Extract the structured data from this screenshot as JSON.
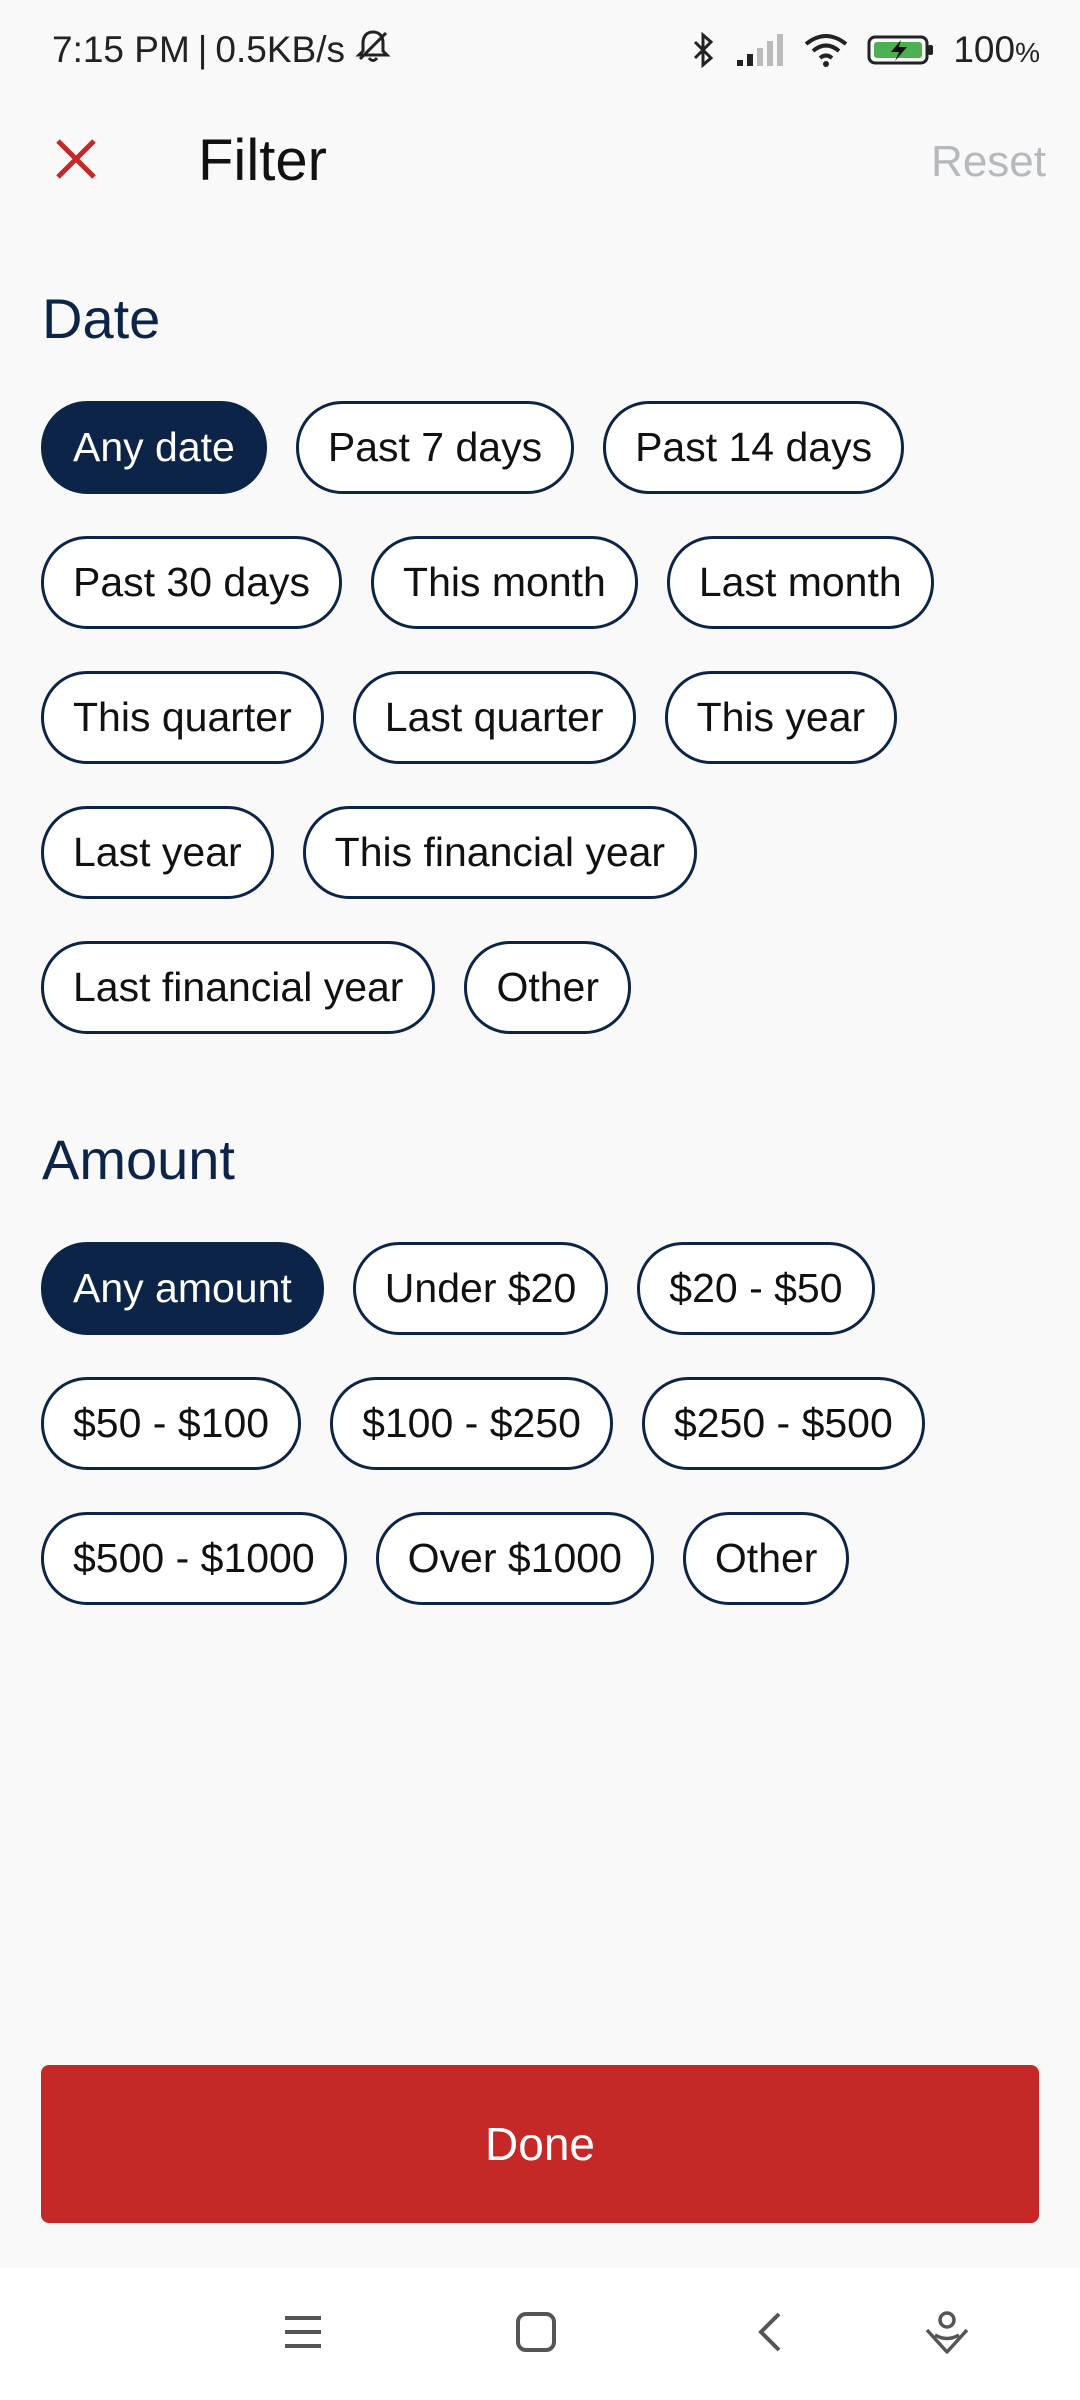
{
  "status_bar": {
    "time": "7:15 PM",
    "separator": "|",
    "network_speed": "0.5KB/s",
    "battery": "100",
    "battery_unit": "%",
    "icons": [
      "mute-bell-icon",
      "bluetooth-icon",
      "signal-icon",
      "wifi-icon",
      "battery-charging-icon"
    ]
  },
  "header": {
    "title": "Filter",
    "reset_label": "Reset",
    "close_icon": "close-icon"
  },
  "date": {
    "title": "Date",
    "options": [
      {
        "label": "Any date",
        "selected": true
      },
      {
        "label": "Past 7 days",
        "selected": false
      },
      {
        "label": "Past 14 days",
        "selected": false
      },
      {
        "label": "Past 30 days",
        "selected": false
      },
      {
        "label": "This month",
        "selected": false
      },
      {
        "label": "Last month",
        "selected": false
      },
      {
        "label": "This quarter",
        "selected": false
      },
      {
        "label": "Last quarter",
        "selected": false
      },
      {
        "label": "This year",
        "selected": false
      },
      {
        "label": "Last year",
        "selected": false
      },
      {
        "label": "This financial year",
        "selected": false
      },
      {
        "label": "Last financial year",
        "selected": false
      },
      {
        "label": "Other",
        "selected": false
      }
    ]
  },
  "amount": {
    "title": "Amount",
    "options": [
      {
        "label": "Any amount",
        "selected": true
      },
      {
        "label": "Under $20",
        "selected": false
      },
      {
        "label": "$20 - $50",
        "selected": false
      },
      {
        "label": "$50 - $100",
        "selected": false
      },
      {
        "label": "$100 - $250",
        "selected": false
      },
      {
        "label": "$250 - $500",
        "selected": false
      },
      {
        "label": "$500 - $1000",
        "selected": false
      },
      {
        "label": "Over $1000",
        "selected": false
      },
      {
        "label": "Other",
        "selected": false
      }
    ]
  },
  "footer": {
    "done_label": "Done"
  },
  "nav_bar": {
    "icons": [
      "menu-icon",
      "home-square-icon",
      "back-chevron-icon",
      "assistant-icon"
    ]
  },
  "colors": {
    "accent_red": "#c62828",
    "navy": "#0b2447",
    "background": "#f9f9fa",
    "reset_gray": "#b5b8bd"
  }
}
